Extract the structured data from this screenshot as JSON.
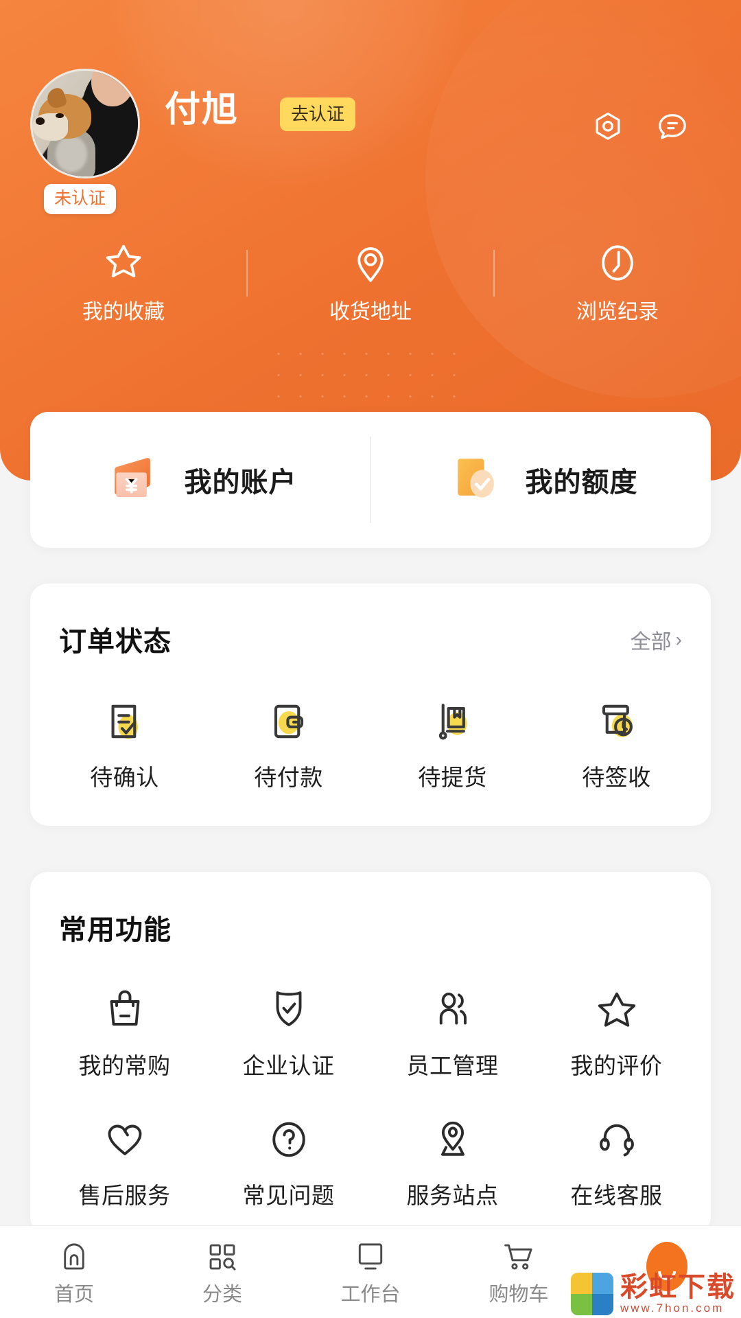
{
  "theme": {
    "primary": "#ef7130",
    "accent_yellow": "#ffd95e",
    "page_bg": "#f4f4f4",
    "card_bg": "#ffffff",
    "text_dark": "#1b1b1b",
    "text_muted": "#8c8c94"
  },
  "header": {
    "avatar_name": "avatar",
    "user_name": "付旭",
    "verify_button": "去认证",
    "verify_badge": "未认证",
    "settings_icon": "gear-icon",
    "message_icon": "message-icon"
  },
  "quick_links": [
    {
      "label": "我的收藏",
      "icon": "star-icon"
    },
    {
      "label": "收货地址",
      "icon": "location-pin-icon"
    },
    {
      "label": "浏览纪录",
      "icon": "history-clock-icon"
    }
  ],
  "account_card": [
    {
      "label": "我的账户",
      "icon": "wallet-yuan-icon"
    },
    {
      "label": "我的额度",
      "icon": "credit-check-icon"
    }
  ],
  "orders": {
    "title": "订单状态",
    "more_label": "全部",
    "more_chevron": "›",
    "items": [
      {
        "label": "待确认",
        "icon": "document-check-icon"
      },
      {
        "label": "待付款",
        "icon": "wallet-pay-icon"
      },
      {
        "label": "待提货",
        "icon": "hand-truck-icon"
      },
      {
        "label": "待签收",
        "icon": "parcel-clock-icon"
      }
    ]
  },
  "functions": {
    "title": "常用功能",
    "items": [
      {
        "label": "我的常购",
        "icon": "shopping-bag-icon"
      },
      {
        "label": "企业认证",
        "icon": "shield-check-icon"
      },
      {
        "label": "员工管理",
        "icon": "people-icon"
      },
      {
        "label": "我的评价",
        "icon": "star-outline-icon"
      },
      {
        "label": "售后服务",
        "icon": "heart-icon"
      },
      {
        "label": "常见问题",
        "icon": "question-circle-icon"
      },
      {
        "label": "服务站点",
        "icon": "map-pin-icon"
      },
      {
        "label": "在线客服",
        "icon": "headset-icon"
      }
    ]
  },
  "tabbar": [
    {
      "label": "首页",
      "icon": "home-icon",
      "active": false
    },
    {
      "label": "分类",
      "icon": "category-grid-icon",
      "active": false
    },
    {
      "label": "工作台",
      "icon": "workbench-monitor-icon",
      "active": false
    },
    {
      "label": "购物车",
      "icon": "shopping-cart-icon",
      "active": false
    },
    {
      "label": "",
      "icon": "profile-avatar-icon",
      "active": true
    }
  ],
  "watermark": {
    "name": "彩虹下载",
    "url": "www.7hon.com"
  }
}
